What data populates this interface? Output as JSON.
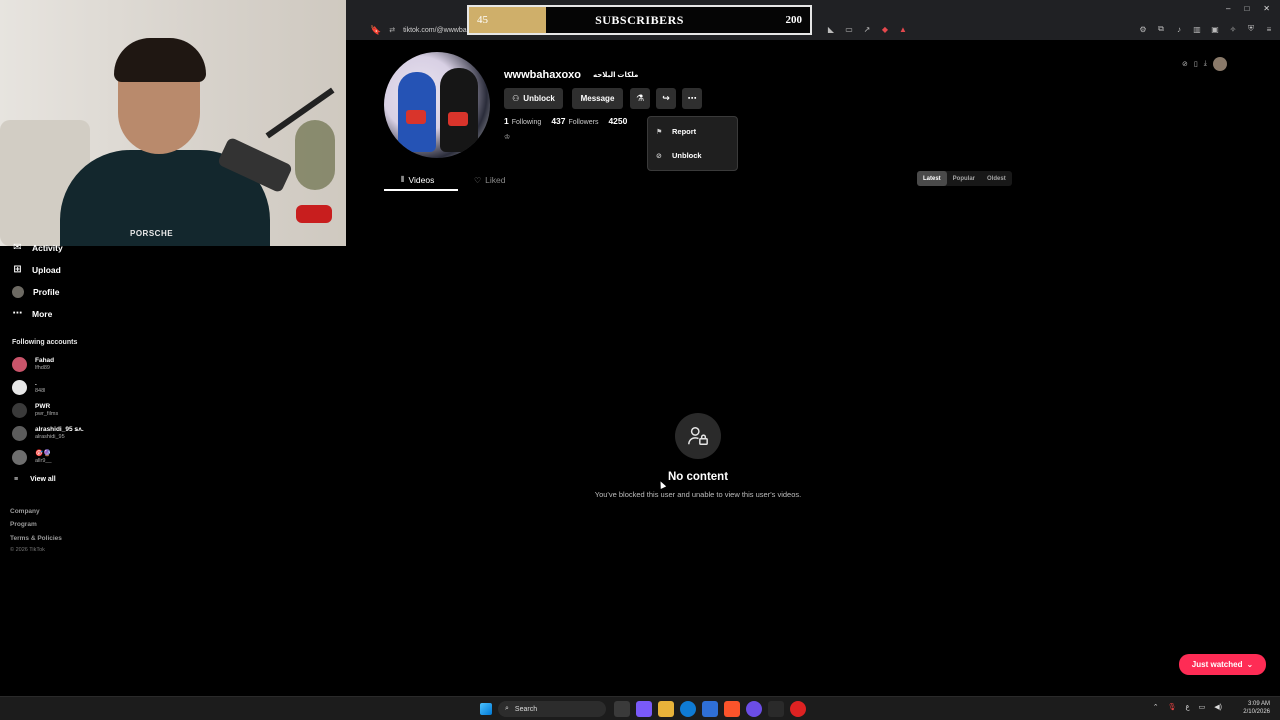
{
  "browser": {
    "url": "tiktok.com/@wwwbahaxoxo",
    "window_buttons": [
      "–",
      "□",
      "✕"
    ]
  },
  "subscriber_goal": {
    "current": "45",
    "label": "SUBSCRIBERS",
    "goal": "200",
    "progress": 0.225
  },
  "webcam": {
    "shirt_text": "PORSCHE"
  },
  "sidebar": {
    "nav": [
      {
        "label": "Activity",
        "icon": "activity-icon"
      },
      {
        "label": "Upload",
        "icon": "upload-icon"
      },
      {
        "label": "Profile",
        "icon": "profile-avatar"
      },
      {
        "label": "More",
        "icon": "more-icon"
      }
    ],
    "following_title": "Following accounts",
    "accounts": [
      {
        "name": "Fahad",
        "handle": "lfhd89"
      },
      {
        "name": ".",
        "handle": "848l"
      },
      {
        "name": "PWR",
        "handle": "pwr_films"
      },
      {
        "name": "alrashidi_95 ꜱʌ.",
        "handle": "alrashidi_95"
      },
      {
        "name": "🎯🔮",
        "handle": "allr9__"
      }
    ],
    "view_all": "View all",
    "footer_links": [
      "Company",
      "Program",
      "Terms & Policies"
    ],
    "copyright": "© 2026 TikTok"
  },
  "profile": {
    "username": "wwwbahaxoxo",
    "nickname": "ملكات البلاحه",
    "unblock_label": "Unblock",
    "message_label": "Message",
    "following_count": "1",
    "following_label": "Following",
    "followers_count": "437",
    "followers_label": "Followers",
    "likes_count": "4250",
    "bio_icon": "♔"
  },
  "dropdown": {
    "report": "Report",
    "unblock": "Unblock"
  },
  "tabs": {
    "videos": "Videos",
    "liked": "Liked"
  },
  "sort": [
    "Latest",
    "Popular",
    "Oldest"
  ],
  "empty_state": {
    "title": "No content",
    "subtitle": "You've blocked this user and unable to view this user's videos."
  },
  "just_watched": "Just watched",
  "taskbar": {
    "search_placeholder": "Search",
    "time": "3:09 AM",
    "date": "2/10/2026",
    "tray_lang": "ع"
  },
  "colors": {
    "accent": "#fe2c55",
    "goal_fill": "#cfaf6a",
    "background": "#000000"
  }
}
